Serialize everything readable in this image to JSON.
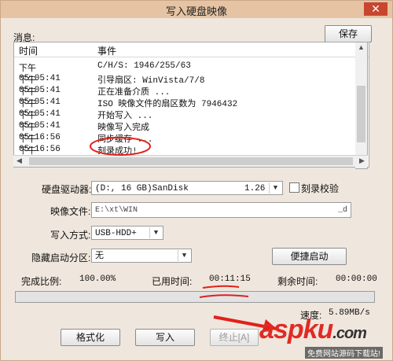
{
  "window": {
    "title": "写入硬盘映像",
    "close_glyph": "✕"
  },
  "messages": {
    "label": "消息:",
    "save_label": "保存",
    "col_time": "时间",
    "col_event": "事件",
    "rows": [
      {
        "time": "下午 05:05:41",
        "event": "C/H/S: 1946/255/63"
      },
      {
        "time": "下午 05:05:41",
        "event": "引导扇区: WinVista/7/8"
      },
      {
        "time": "下午 05:05:41",
        "event": "正在准备介质 ..."
      },
      {
        "time": "下午 05:05:41",
        "event": "ISO 映像文件的扇区数为 7946432"
      },
      {
        "time": "下午 05:05:41",
        "event": "开始写入 ..."
      },
      {
        "time": "下午 05:16:56",
        "event": "映像写入完成"
      },
      {
        "time": "下午 05:16:56",
        "event": "同步缓存 ..."
      },
      {
        "time": "下午 05:16:56",
        "event": "刻录成功!"
      }
    ]
  },
  "drive": {
    "label": "硬盘驱动器:",
    "value": "(D:, 16 GB)SanDisk",
    "version": "1.26",
    "verify_label": "刻录校验"
  },
  "image_file": {
    "label": "映像文件:",
    "value_start": "E:\\xt\\WIN",
    "value_end": "_d"
  },
  "write_mode": {
    "label": "写入方式:",
    "value": "USB-HDD+"
  },
  "hidden_partition": {
    "label": "隐藏启动分区:",
    "value": "无"
  },
  "boot_button": "便捷启动",
  "status": {
    "done_label": "完成比例:",
    "done_value": "100.00%",
    "used_label": "已用时间:",
    "used_value": "00:11:15",
    "left_label": "剩余时间:",
    "left_value": "00:00:00",
    "speed_label": "速度:",
    "speed_value": "5.89MB/s",
    "progress": 1.0
  },
  "buttons": {
    "format": "格式化",
    "write": "写入",
    "stop": "终止[A]"
  },
  "watermark": {
    "main": "asp",
    "ku": "ku",
    "dot": ".com",
    "sub": "免费网站源码下载站!"
  },
  "colors": {
    "annotation_red": "#e0201c",
    "title_bg": "#e6c3a2"
  }
}
